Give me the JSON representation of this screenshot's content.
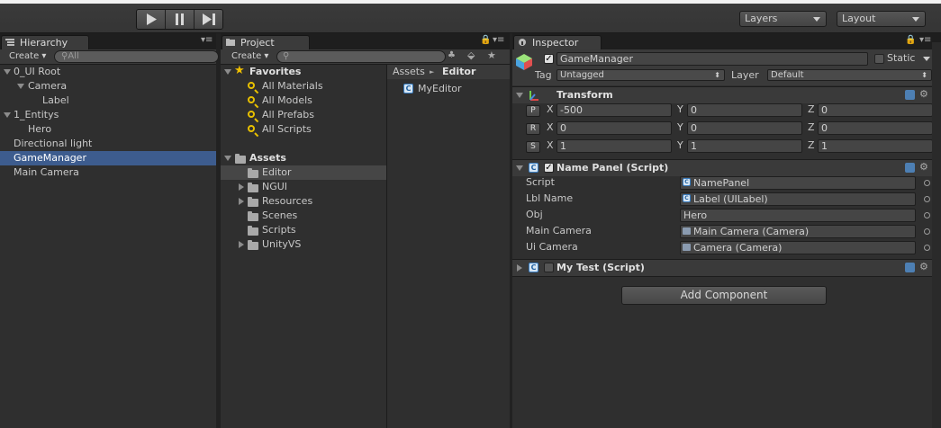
{
  "toolbar": {
    "layers_label": "Layers",
    "layout_label": "Layout"
  },
  "hierarchy": {
    "tab": "Hierarchy",
    "create": "Create",
    "search_placeholder": "All",
    "items": [
      "0_UI Root",
      "Camera",
      "Label",
      "1_Entitys",
      "Hero",
      "Directional light",
      "GameManager",
      "Main Camera"
    ]
  },
  "project": {
    "tab": "Project",
    "create": "Create",
    "favorites": "Favorites",
    "favorite_items": [
      "All Materials",
      "All Models",
      "All Prefabs",
      "All Scripts"
    ],
    "assets": "Assets",
    "asset_folders": [
      "Editor",
      "NGUI",
      "Resources",
      "Scenes",
      "Scripts",
      "UnityVS"
    ],
    "breadcrumb_root": "Assets",
    "breadcrumb_sep": "►",
    "breadcrumb_current": "Editor",
    "files": [
      "MyEditor"
    ]
  },
  "inspector": {
    "tab": "Inspector",
    "object_name": "GameManager",
    "static_label": "Static",
    "tag_label": "Tag",
    "tag_value": "Untagged",
    "layer_label": "Layer",
    "layer_value": "Default",
    "transform": {
      "title": "Transform",
      "rows": [
        {
          "btn": "P",
          "x": "-500",
          "y": "0",
          "z": "0"
        },
        {
          "btn": "R",
          "x": "0",
          "y": "0",
          "z": "0"
        },
        {
          "btn": "S",
          "x": "1",
          "y": "1",
          "z": "1"
        }
      ],
      "axis_x": "X",
      "axis_y": "Y",
      "axis_z": "Z"
    },
    "name_panel": {
      "title": "Name Panel (Script)",
      "fields": [
        {
          "label": "Script",
          "value": "NamePanel"
        },
        {
          "label": "Lbl Name",
          "value": "Label (UILabel)"
        },
        {
          "label": "Obj",
          "value": "Hero"
        },
        {
          "label": "Main Camera",
          "value": "Main Camera (Camera)"
        },
        {
          "label": "Ui Camera",
          "value": "Camera (Camera)"
        }
      ]
    },
    "my_test": {
      "title": "My Test (Script)"
    },
    "add_component": "Add Component"
  },
  "icon_names": [
    "play-icon",
    "pause-icon",
    "step-icon",
    "star-icon",
    "folder-icon",
    "lock-icon",
    "menu-icon",
    "gear-icon",
    "script-icon",
    "help-icon",
    "search-icon"
  ],
  "colors": {
    "selection": "#3d5c8e",
    "background": "#2f2f2f"
  }
}
